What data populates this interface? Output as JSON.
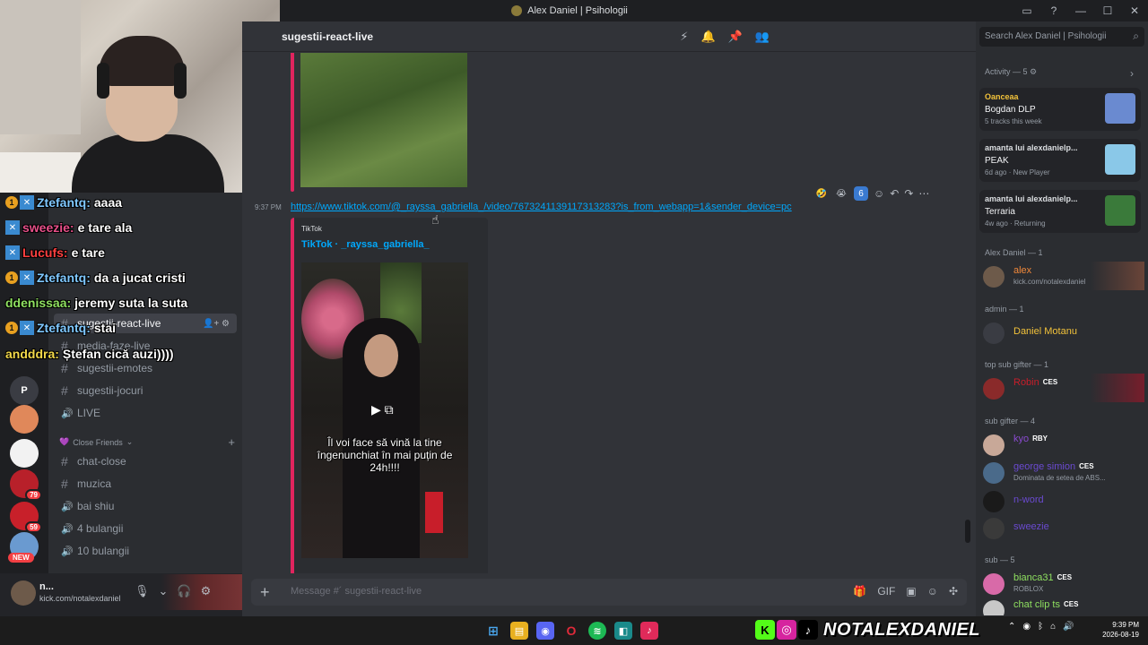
{
  "window": {
    "title": "Alex Daniel | Psihologii",
    "controls": [
      "—",
      "☐",
      "✕"
    ]
  },
  "servers": [
    {
      "name": "server-1",
      "color": "#3a3c43",
      "glyph": "P",
      "badge": ""
    },
    {
      "name": "server-2",
      "color": "#e0885a",
      "glyph": "",
      "badge": ""
    },
    {
      "name": "server-3",
      "color": "#f2f2f2",
      "glyph": "",
      "badge": ""
    },
    {
      "name": "server-4",
      "color": "#b8202a",
      "glyph": "",
      "badge": "79"
    },
    {
      "name": "server-5",
      "color": "#c8202a",
      "glyph": "",
      "badge": "59"
    },
    {
      "name": "server-6",
      "color": "#6a9ad0",
      "glyph": "",
      "badge": ""
    }
  ],
  "new_badge": "NEW",
  "channels": {
    "items": [
      {
        "type": "text",
        "label": "sugestii-react-live",
        "active": true
      },
      {
        "type": "text",
        "label": "media-faze-live",
        "active": false
      },
      {
        "type": "text",
        "label": "sugestii-emotes",
        "active": false
      },
      {
        "type": "text",
        "label": "sugestii-jocuri",
        "active": false
      },
      {
        "type": "voice",
        "label": "LIVE",
        "active": false
      }
    ],
    "category": "Close Friends",
    "category_items": [
      {
        "type": "text",
        "label": "chat-close"
      },
      {
        "type": "text",
        "label": "muzica"
      },
      {
        "type": "voice",
        "label": "bai shiu"
      },
      {
        "type": "voice",
        "label": "4 bulangii"
      },
      {
        "type": "voice",
        "label": "10 bulangii"
      }
    ]
  },
  "user_panel": {
    "name": "n...",
    "status": "kick.com/notalexdaniel"
  },
  "stream_chat": [
    {
      "badge": "1",
      "user": "Ztefantq:",
      "msg": "aaaa",
      "color": "#7fc8ff"
    },
    {
      "badge": "",
      "user": "sweezie:",
      "msg": "e tare ala",
      "color": "#e8508a"
    },
    {
      "badge": "",
      "user": "Lucufs:",
      "msg": "e tare",
      "color": "#ff4040"
    },
    {
      "badge": "1",
      "user": "Ztefantq:",
      "msg": "da a jucat cristi",
      "color": "#7fc8ff"
    },
    {
      "badge": "",
      "user": "ddenissaa:",
      "msg": "jeremy suta la suta",
      "color": "#8fe060"
    },
    {
      "badge": "1",
      "user": "Ztefantq:",
      "msg": "stai",
      "color": "#7fc8ff"
    },
    {
      "badge": "",
      "user": "andddra:",
      "msg": "Ștefan cică auzi))))",
      "color": "#f2d84a"
    }
  ],
  "header": {
    "channel": "sugestii-react-live",
    "search_placeholder": "Search Alex Daniel | Psihologii"
  },
  "message": {
    "timestamp": "9:37 PM",
    "link": "https://www.tiktok.com/@_rayssa_gabriella_/video/7673241139117313283?is_from_webapp=1&sender_device=pc",
    "embed_provider": "TikTok",
    "embed_author": "TikTok · _rayssa_gabriella_",
    "caption": "Îl voi face să vină la tine îngenunchiat în mai puțin de 24h!!!!"
  },
  "reactions": [
    {
      "emoji": "🤣",
      "count": ""
    },
    {
      "emoji": "😭",
      "count": ""
    },
    {
      "emoji": "6",
      "count": "6"
    }
  ],
  "composer": {
    "placeholder": "Message #´ sugestii-react-live"
  },
  "members": {
    "activity_header": "Activity — 5",
    "activities": [
      {
        "user": "Oanceaa",
        "title": "Bogdan DLP",
        "detail": "5 tracks this week",
        "thumb": "#6a8ad0"
      },
      {
        "user": "amanta lui alexdanielp...",
        "title": "PEAK",
        "detail": "6d ago · New Player",
        "thumb": "#8ac8e8"
      },
      {
        "user": "amanta lui alexdanielp...",
        "title": "Terraria",
        "detail": "4w ago · Returning",
        "thumb": "#3a7a3a"
      }
    ],
    "groups": [
      {
        "header": "Alex Daniel — 1",
        "members": [
          {
            "name": "alex",
            "status": "kick.com/notalexdaniel",
            "color": "#f0883a",
            "tag": ""
          }
        ]
      },
      {
        "header": "admin — 1",
        "members": [
          {
            "name": "Daniel Motanu",
            "status": "",
            "color": "#f2c23a",
            "tag": ""
          }
        ]
      },
      {
        "header": "top sub gifter — 1",
        "members": [
          {
            "name": "Robin",
            "status": "",
            "color": "#c81e2a",
            "tag": "CES"
          }
        ]
      },
      {
        "header": "sub gifter — 4",
        "members": [
          {
            "name": "kyo",
            "status": "",
            "color": "#8a4ad0",
            "tag": "RBY"
          },
          {
            "name": "george simion",
            "status": "Dominata de setea de ABS...",
            "color": "#6a4ad0",
            "tag": "CES"
          },
          {
            "name": "n-word",
            "status": "",
            "color": "#6a4ad0",
            "tag": ""
          },
          {
            "name": "sweezie",
            "status": "",
            "color": "#6a4ad0",
            "tag": ""
          }
        ]
      },
      {
        "header": "sub — 5",
        "members": [
          {
            "name": "bianca31",
            "status": "ROBLOX",
            "color": "#8fe060",
            "tag": "CES"
          },
          {
            "name": "chat clip ts",
            "status": "",
            "color": "#8fe060",
            "tag": "CES"
          }
        ]
      }
    ]
  },
  "taskbar": {
    "brand": "NOTALEXDANIEL",
    "time": "9:39 PM",
    "date": "2026-08-19"
  },
  "colors": {
    "accent": "#e0245e",
    "link": "#00a8fc",
    "bg": "#313338"
  }
}
